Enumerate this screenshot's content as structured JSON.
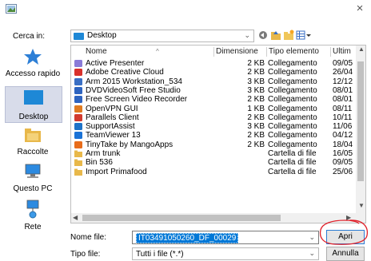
{
  "title_bar": {
    "close_glyph": "×"
  },
  "lookin": {
    "label": "Cerca in:",
    "value": "Desktop",
    "dropdown_glyph": "⌄"
  },
  "places": [
    {
      "id": "recent",
      "label": "Accesso rapido",
      "icon": "star-icon",
      "selected": false
    },
    {
      "id": "desktop",
      "label": "Desktop",
      "icon": "desktop-icon",
      "selected": true
    },
    {
      "id": "libs",
      "label": "Raccolte",
      "icon": "folder-icon",
      "selected": false
    },
    {
      "id": "pc",
      "label": "Questo PC",
      "icon": "computer-icon",
      "selected": false
    },
    {
      "id": "net",
      "label": "Rete",
      "icon": "network-icon",
      "selected": false
    }
  ],
  "columns": {
    "name": "Nome",
    "size": "Dimensione",
    "type": "Tipo elemento",
    "date": "Ultim"
  },
  "files": [
    {
      "name": "Active Presenter",
      "size": "2 KB",
      "type": "Collegamento",
      "date": "09/05",
      "icon_color": "#8a7bd8"
    },
    {
      "name": "Adobe Creative Cloud",
      "size": "2 KB",
      "type": "Collegamento",
      "date": "26/04",
      "icon_color": "#d9312b"
    },
    {
      "name": "Arm 2015 Workstation_534",
      "size": "3 KB",
      "type": "Collegamento",
      "date": "12/12",
      "icon_color": "#3a6fc4"
    },
    {
      "name": "DVDVideoSoft Free Studio",
      "size": "3 KB",
      "type": "Collegamento",
      "date": "08/01",
      "icon_color": "#2e64c0"
    },
    {
      "name": "Free Screen Video Recorder",
      "size": "2 KB",
      "type": "Collegamento",
      "date": "08/01",
      "icon_color": "#2e64c0"
    },
    {
      "name": "OpenVPN GUI",
      "size": "1 KB",
      "type": "Collegamento",
      "date": "08/11",
      "icon_color": "#e07b21"
    },
    {
      "name": "Parallels Client",
      "size": "2 KB",
      "type": "Collegamento",
      "date": "10/11",
      "icon_color": "#d23a2e"
    },
    {
      "name": "SupportAssist",
      "size": "3 KB",
      "type": "Collegamento",
      "date": "11/06",
      "icon_color": "#1e73c8"
    },
    {
      "name": "TeamViewer 13",
      "size": "2 KB",
      "type": "Collegamento",
      "date": "04/12",
      "icon_color": "#1a72d6"
    },
    {
      "name": "TinyTake by MangoApps",
      "size": "2 KB",
      "type": "Collegamento",
      "date": "18/04",
      "icon_color": "#e86c1a"
    },
    {
      "name": "Arm trunk",
      "size": "",
      "type": "Cartella di file",
      "date": "16/05",
      "icon_color": "#e8b84a"
    },
    {
      "name": "Bin 536",
      "size": "",
      "type": "Cartella di file",
      "date": "09/05",
      "icon_color": "#e8b84a"
    },
    {
      "name": "Import Primafood",
      "size": "",
      "type": "Cartella di file",
      "date": "25/06",
      "icon_color": "#e8b84a"
    }
  ],
  "filename": {
    "label": "Nome file:",
    "value": "IT03491050260_DF_00029"
  },
  "filetype": {
    "label": "Tipo file:",
    "value": "Tutti i file (*.*)"
  },
  "buttons": {
    "open": "Apri",
    "cancel": "Annulla"
  },
  "colors": {
    "accent": "#0078d7",
    "annotation": "#e0202a",
    "selected_place": "#d8dcea"
  }
}
